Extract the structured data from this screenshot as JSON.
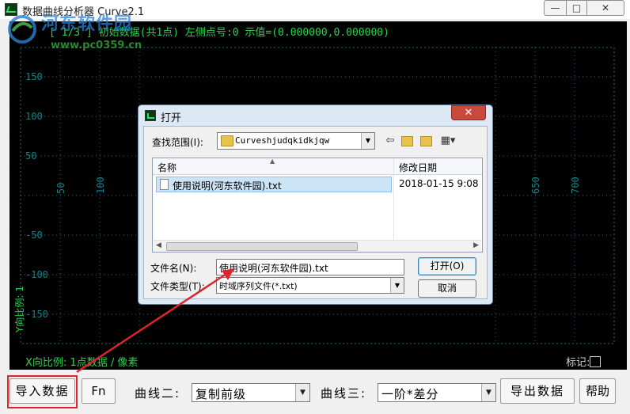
{
  "window": {
    "title": "数据曲线分析器 Curve2.1",
    "minimize": "—",
    "maximize": "□",
    "close": "✕"
  },
  "watermark": {
    "site_name": "河东软件园",
    "url": "www.pc0359.cn"
  },
  "plot": {
    "status": "[ 1/3 ] 初始数据(共1点) 左侧点号:0 示值=(0.000000,0.000000)",
    "y_ticks": [
      "150",
      "100",
      "50",
      "-50",
      "-100",
      "-150"
    ],
    "x_ticks": [
      "50",
      "100",
      "650",
      "700"
    ],
    "y_scale": "Y向比例: 1",
    "x_scale": "X向比例: 1点数据 / 像素",
    "marker_label": "标记:"
  },
  "toolbar": {
    "import_label": "导入数据",
    "fn_label": "Fn",
    "curve2_label": "曲线二:",
    "curve2_value": "复制前级",
    "curve3_label": "曲线三:",
    "curve3_value": "一阶*差分",
    "export_label": "导出数据",
    "help_label": "帮助"
  },
  "dialog": {
    "title": "打开",
    "close": "✕",
    "look_in_label": "查找范围(I):",
    "look_in_value": "Curveshjudqkidkjqw",
    "columns": [
      "名称",
      "修改日期"
    ],
    "files": [
      {
        "name": "使用说明(河东软件园).txt",
        "modified": "2018-01-15 9:08"
      }
    ],
    "filename_label": "文件名(N):",
    "filename_value": "使用说明(河东软件园).txt",
    "filetype_label": "文件类型(T):",
    "filetype_value": "时域序列文件(*.txt)",
    "open_label": "打开(O)",
    "cancel_label": "取消"
  },
  "colors": {
    "plot_bg": "#000000",
    "plot_text": "#2bd24a",
    "grid": "#1a6f76",
    "highlight": "#e0242d"
  }
}
